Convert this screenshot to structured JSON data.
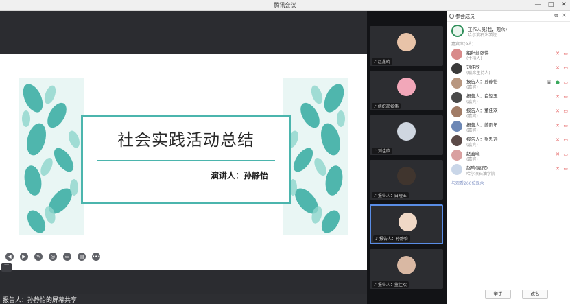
{
  "window": {
    "title": "腾讯会议",
    "buttons": [
      "—",
      "□",
      "✕"
    ]
  },
  "slide": {
    "headline": "社会实践活动总结",
    "speaker": "演讲人：孙静怡"
  },
  "share_bar": {
    "text": "报告人：孙静怡的屏幕共享"
  },
  "controls": [
    "◀",
    "▶",
    "✎",
    "◎",
    "▭",
    "▤",
    "•••"
  ],
  "controls_icons": [
    "prev-icon",
    "next-icon",
    "pen-icon",
    "pointer-icon",
    "camera-icon",
    "chat-icon",
    "more-icon"
  ],
  "gallery": [
    {
      "name": "赵鑫晓",
      "avatar_color": "#e8c3a8"
    },
    {
      "name": "组织部张伟",
      "avatar_color": "#f2a7b9"
    },
    {
      "name": "刘佳欣",
      "avatar_color": "#cfd6e0"
    },
    {
      "name": "报告人：白短玉",
      "avatar_color": "#40352e"
    },
    {
      "name": "报告人：孙静怡",
      "avatar_color": "#f0d8c6"
    },
    {
      "name": "报告人：董佳欢",
      "avatar_color": "#d9b8a3"
    }
  ],
  "panel": {
    "title": "参会成员",
    "host": {
      "name": "工作人员(我，观众)",
      "org": "哈尔滨石油学院"
    },
    "group_label": "嘉宾席(9人)",
    "members": [
      {
        "name": "组织部张伟",
        "role": "(主持人)",
        "color": "#d88a8a"
      },
      {
        "name": "刘佳欣",
        "role": "(联席主持人)",
        "color": "#3a3a3a"
      },
      {
        "name": "报告人：孙静怡",
        "role": "(嘉宾)",
        "color": "#b89780",
        "speaking": true
      },
      {
        "name": "报告人：白短玉",
        "role": "(嘉宾)",
        "color": "#4a4a4a"
      },
      {
        "name": "报告人：董佳欢",
        "role": "(嘉宾)",
        "color": "#a17c66"
      },
      {
        "name": "报告人：姜雨年",
        "role": "(嘉宾)",
        "color": "#6c87b5"
      },
      {
        "name": "报告人：张思远",
        "role": "(嘉宾)",
        "color": "#5b4a48"
      },
      {
        "name": "赵鑫晓",
        "role": "(嘉宾)",
        "color": "#d9a0a0"
      },
      {
        "name": "赵晴(嘉宾)",
        "role": "哈尔滨石油学院",
        "color": "#c9d6e8"
      }
    ],
    "invite_text": "与观看266位观众",
    "raise_hand": "举手",
    "rename": "改名"
  },
  "colors": {
    "accent_teal": "#4bb5ad",
    "mute_red": "#e35a5a",
    "mic_green": "#39a85c"
  }
}
